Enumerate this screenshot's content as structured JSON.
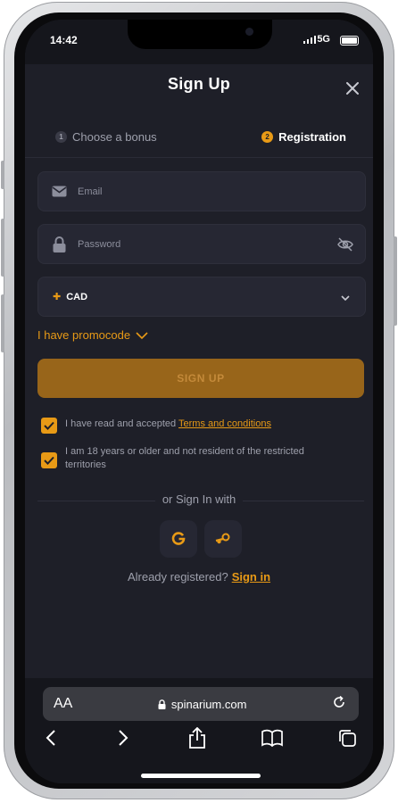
{
  "status_bar": {
    "time": "14:42",
    "network": "5G"
  },
  "modal": {
    "title": "Sign Up",
    "steps": [
      {
        "number": "1",
        "label": "Choose a bonus"
      },
      {
        "number": "2",
        "label": "Registration"
      }
    ],
    "fields": {
      "email": {
        "placeholder": "Email"
      },
      "password": {
        "placeholder": "Password"
      },
      "currency": {
        "value": "CAD"
      }
    },
    "promocode_label": "I have promocode",
    "signup_button": "SIGN UP",
    "terms": {
      "prefix": "I have read and accepted ",
      "link": "Terms and conditions"
    },
    "age_confirmation": "I am 18 years or older and not resident of the restricted territories",
    "or_sign_in_with": "or Sign In with",
    "already_registered": "Already registered?",
    "sign_in_link": "Sign in"
  },
  "browser": {
    "aa_label": "AA",
    "url": "spinarium.com"
  },
  "colors": {
    "accent": "#e89a16",
    "background": "#1e1f28",
    "field": "#262733"
  }
}
